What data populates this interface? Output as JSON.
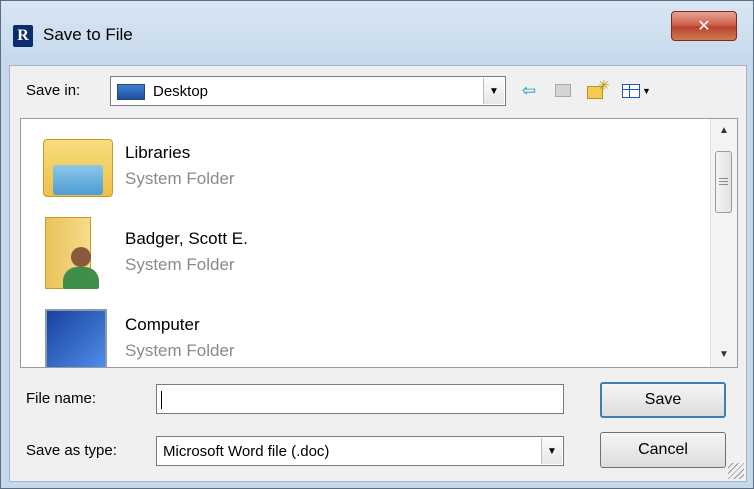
{
  "window": {
    "title": "Save to File",
    "app_icon_letter": "R",
    "close_glyph": "✕"
  },
  "toolbar": {
    "save_in_label": "Save in:",
    "save_in_value": "Desktop",
    "icons": [
      "back-arrow-icon",
      "up-folder-icon",
      "new-folder-icon",
      "view-menu-icon"
    ]
  },
  "files": [
    {
      "name": "Libraries",
      "type": "System Folder",
      "icon": "libraries-icon"
    },
    {
      "name": "Badger, Scott E.",
      "type": "System Folder",
      "icon": "user-folder-icon"
    },
    {
      "name": "Computer",
      "type": "System Folder",
      "icon": "computer-icon"
    }
  ],
  "form": {
    "file_name_label": "File name:",
    "file_name_value": "",
    "save_as_type_label": "Save as type:",
    "save_as_type_value": "Microsoft Word file (.doc)",
    "save_button": "Save",
    "cancel_button": "Cancel"
  },
  "colors": {
    "close_button": "#c85a45",
    "title_bar": "#c6d9ec",
    "default_button_border": "#3c7fb1"
  }
}
